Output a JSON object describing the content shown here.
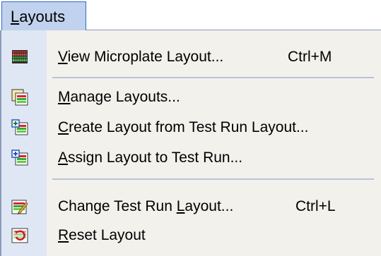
{
  "menubar": {
    "title_accel": "L",
    "title_rest": "ayouts"
  },
  "items": [
    {
      "pre": "",
      "accel": "V",
      "post": "iew Microplate Layout...",
      "shortcut": "Ctrl+M",
      "icon": "microplate-grid-icon"
    },
    {
      "pre": "",
      "accel": "M",
      "post": "anage Layouts...",
      "shortcut": "",
      "icon": "manage-layouts-icon"
    },
    {
      "pre": "",
      "accel": "C",
      "post": "reate Layout from Test Run Layout...",
      "shortcut": "",
      "icon": "create-layout-icon"
    },
    {
      "pre": "",
      "accel": "A",
      "post": "ssign Layout to Test Run...",
      "shortcut": "",
      "icon": "assign-layout-icon"
    },
    {
      "pre": "Change Test Run ",
      "accel": "L",
      "post": "ayout...",
      "shortcut": "Ctrl+L",
      "icon": "change-layout-icon"
    },
    {
      "pre": "",
      "accel": "R",
      "post": "eset Layout",
      "shortcut": "",
      "icon": "reset-layout-icon"
    }
  ]
}
